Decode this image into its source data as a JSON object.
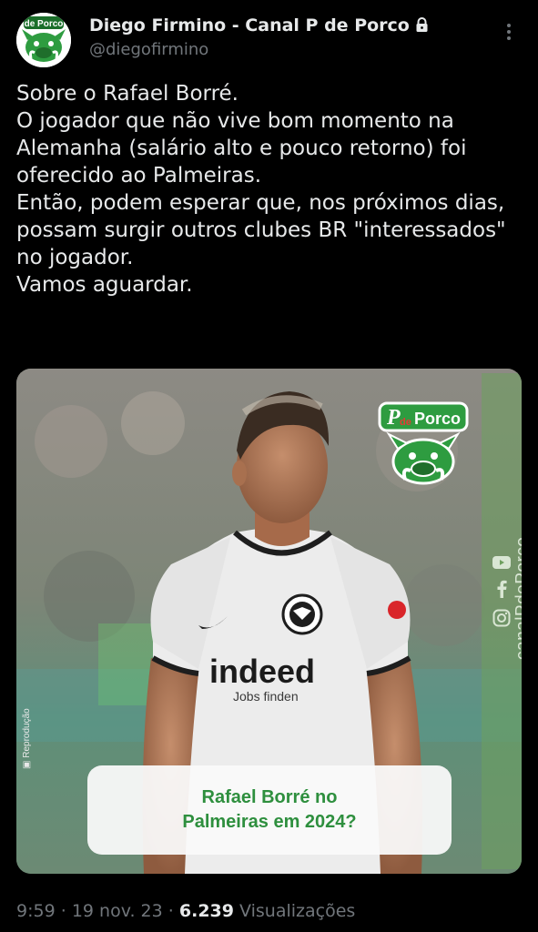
{
  "author": {
    "display_name": "Diego Firmino - Canal P de Porco",
    "handle": "@diegofirmino",
    "avatar_text": "de Porco"
  },
  "tweet": {
    "text": "Sobre o Rafael Borré.\nO jogador que não vive bom momento na Alemanha (salário alto e pouco retorno) foi oferecido ao Palmeiras.\nEntão, podem esperar que, nos próximos dias, possam surgir outros clubes BR \"interessados\" no jogador.\nVamos aguardar."
  },
  "media": {
    "credit": "Reprodução",
    "logo_text_p": "P",
    "logo_text_de": "de",
    "logo_text_porco": "Porco",
    "side_handle": "canalPdePorco",
    "shirt_sponsor": "indeed",
    "shirt_slogan": "Jobs finden",
    "caption": "Rafael Borré no\nPalmeiras em 2024?",
    "colors": {
      "brand_green": "#2e8f3e",
      "shirt": "#ececec",
      "background": "#6f7d70"
    }
  },
  "meta": {
    "time": "9:59",
    "separator": "·",
    "date": "19 nov. 23",
    "views_count": "6.239",
    "views_label": "Visualizações"
  }
}
